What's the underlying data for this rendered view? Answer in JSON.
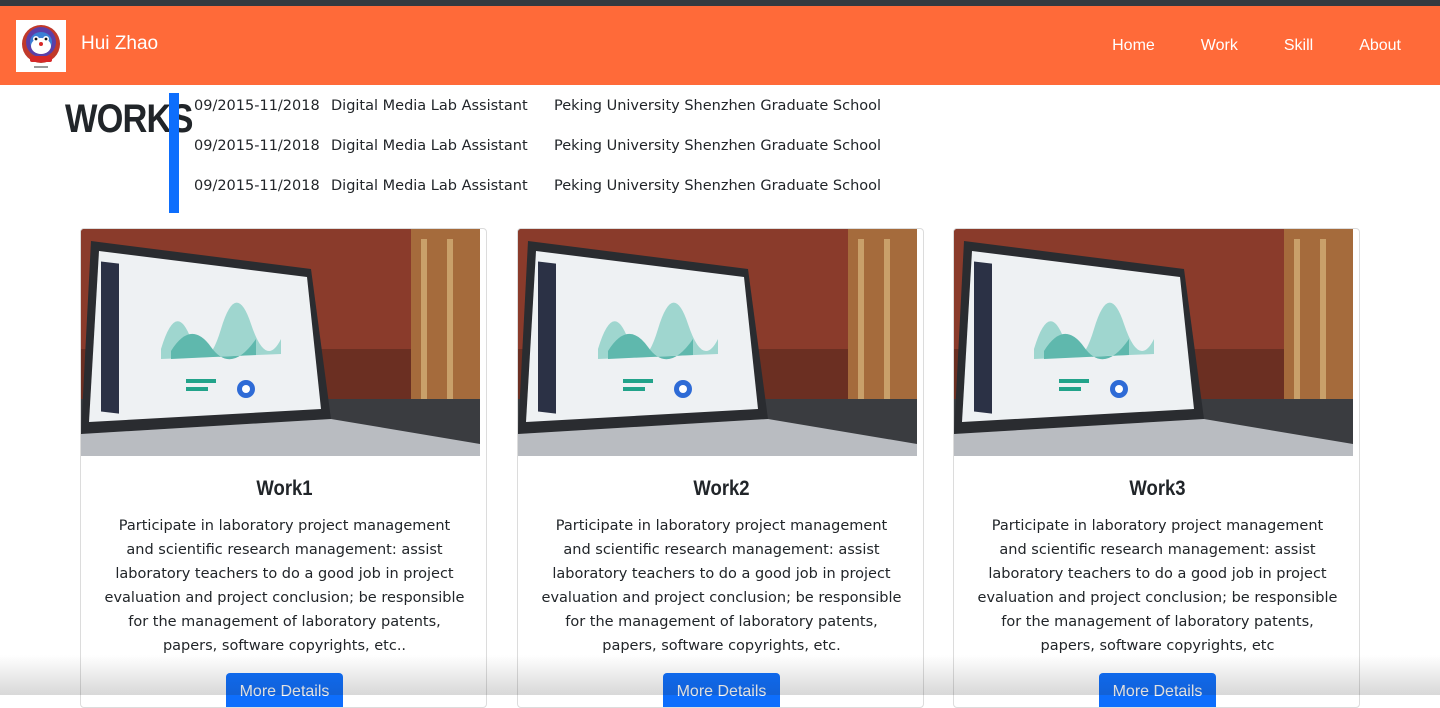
{
  "navbar": {
    "brand_name": "Hui Zhao",
    "links": [
      "Home",
      "Work",
      "Skill",
      "About"
    ],
    "background_color": "#ff6a39"
  },
  "works": {
    "title": "WORKS",
    "accent_color": "#0d6efd",
    "timeline": [
      {
        "date": "09/2015-11/2018",
        "role": "Digital Media Lab Assistant",
        "organization": "Peking University Shenzhen Graduate School"
      },
      {
        "date": "09/2015-11/2018",
        "role": "Digital Media Lab Assistant",
        "organization": "Peking University Shenzhen Graduate School"
      },
      {
        "date": "09/2015-11/2018",
        "role": "Digital Media Lab Assistant",
        "organization": "Peking University Shenzhen Graduate School"
      }
    ]
  },
  "cards": [
    {
      "title": "Work1",
      "text": "Participate in laboratory project management and scientific research management: assist laboratory teachers to do a good job in project evaluation and project conclusion; be responsible for the management of laboratory patents, papers, software copyrights, etc..",
      "button": "More Details"
    },
    {
      "title": "Work2",
      "text": "Participate in laboratory project management and scientific research management: assist laboratory teachers to do a good job in project evaluation and project conclusion; be responsible for the management of laboratory patents, papers, software copyrights, etc.",
      "button": "More Details"
    },
    {
      "title": "Work3",
      "text": "Participate in laboratory project management and scientific research management: assist laboratory teachers to do a good job in project evaluation and project conclusion; be responsible for the management of laboratory patents, papers, software copyrights, etc",
      "button": "More Details"
    }
  ]
}
